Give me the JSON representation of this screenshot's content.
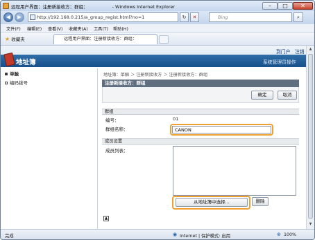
{
  "window": {
    "title": "远程用户界面：注册新接收方：群组：",
    "browser": "Windows Internet Explorer",
    "min_glyph": "–",
    "max_glyph": "□",
    "close_glyph": "✕"
  },
  "addressbar": {
    "back_glyph": "◀",
    "forward_glyph": "▶",
    "url": "http://192.168.0.215/a_group_regist.html?no=1",
    "refresh_glyph": "↻",
    "stop_glyph": "✕",
    "search_placeholder": "Bing",
    "search_glyph": "⌕"
  },
  "menu": [
    "文件(F)",
    "编辑(E)",
    "查看(V)",
    "收藏夹(A)",
    "工具(T)",
    "帮助(H)"
  ],
  "favbar": {
    "favorites_label": "收藏夹",
    "tab_title": "远程用户界面：注册新接收方：群组："
  },
  "header": {
    "app_title": "地址簿",
    "to_portal": "到门户",
    "logout": "注销",
    "admin_link": "系统管理员操作"
  },
  "sidebar": {
    "items": [
      "单触",
      "编码拨号"
    ]
  },
  "main": {
    "breadcrumb": "地址簿：单触 ＞ 注册新接收方 ＞ 注册新接收方：群组",
    "section_title": "注册新接收方：群组",
    "ok_label": "确定",
    "cancel_label": "取消",
    "group_section": "群组",
    "number_label": "编号：",
    "number_value": "01",
    "group_name_label": "群组名称：",
    "group_name_value": "CANON",
    "member_section": "成员设置",
    "member_list_label": "成员列表：",
    "select_from_book_label": "从地址簿中选择...",
    "delete_label": "删除"
  },
  "statusbar": {
    "status": "完成",
    "zone": "Internet | 保护模式: 启用",
    "zoom": "100%"
  }
}
